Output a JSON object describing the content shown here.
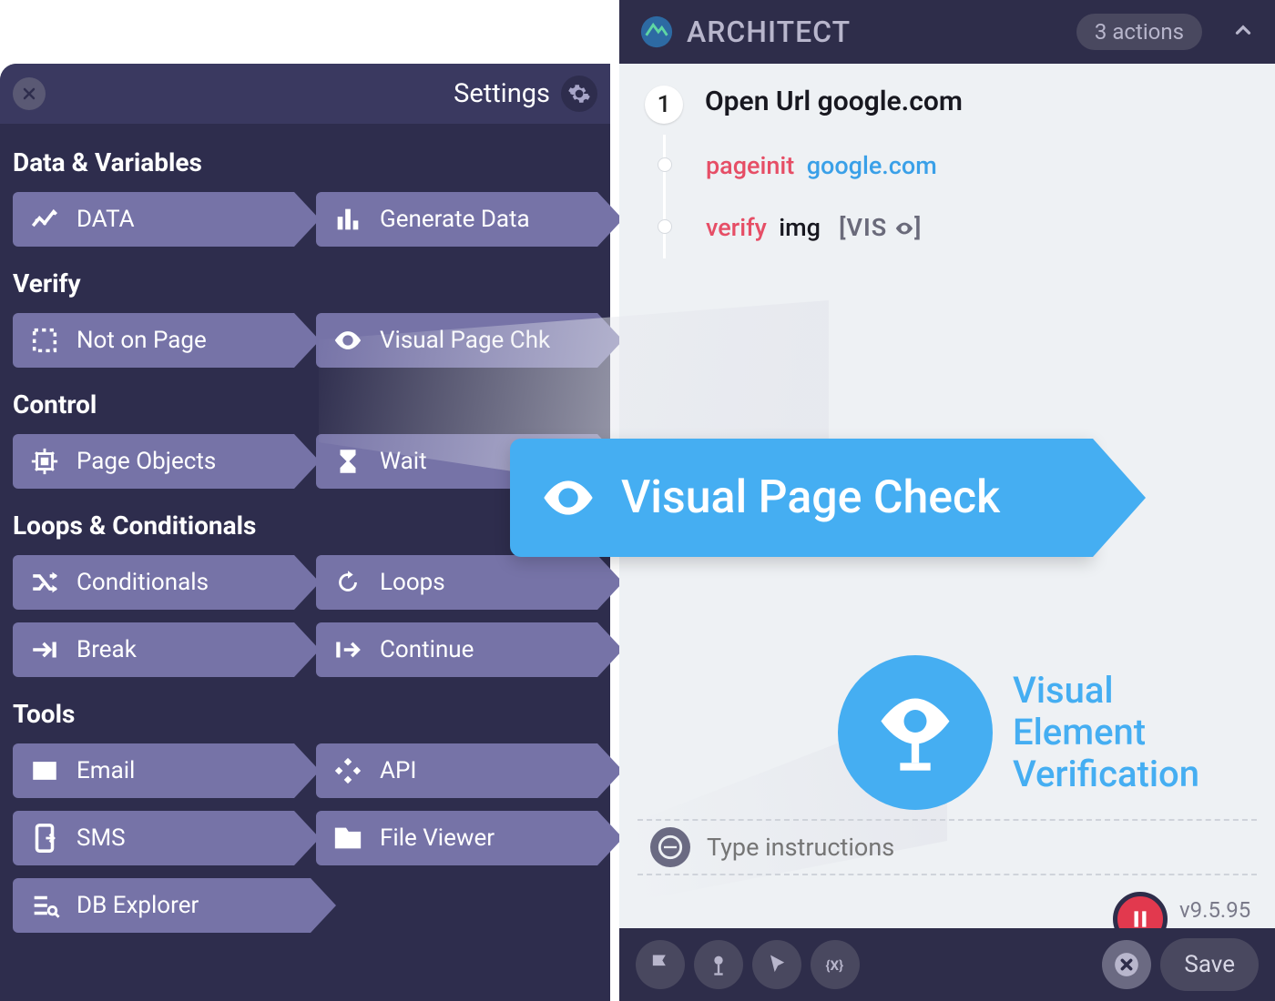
{
  "left": {
    "settings_label": "Settings",
    "sections": {
      "data_vars": {
        "title": "Data & Variables",
        "data": "DATA",
        "generate": "Generate Data"
      },
      "verify": {
        "title": "Verify",
        "not_on_page": "Not on Page",
        "visual_page_chk": "Visual Page Chk"
      },
      "control": {
        "title": "Control",
        "page_objects": "Page Objects",
        "wait": "Wait"
      },
      "loops": {
        "title": "Loops & Conditionals",
        "conditionals": "Conditionals",
        "loops": "Loops",
        "break": "Break",
        "continue": "Continue"
      },
      "tools": {
        "title": "Tools",
        "email": "Email",
        "api": "API",
        "sms": "SMS",
        "file_viewer": "File Viewer",
        "db_explorer": "DB Explorer"
      }
    }
  },
  "right": {
    "app_title": "ARCHITECT",
    "actions_count": "3 actions",
    "step1": {
      "num": "1",
      "title": "Open Url google.com",
      "sub1_kw": "pageinit",
      "sub1_val": "google.com",
      "sub2_kw": "verify",
      "sub2_tgt": "img",
      "sub2_vis": "[VIS ",
      "sub2_vis_close": "]"
    },
    "drag_label": "Visual Page Check",
    "vev_line": "Visual\nElement\nVerification",
    "input_placeholder": "Type instructions",
    "version": "v9.5.95",
    "save": "Save"
  }
}
